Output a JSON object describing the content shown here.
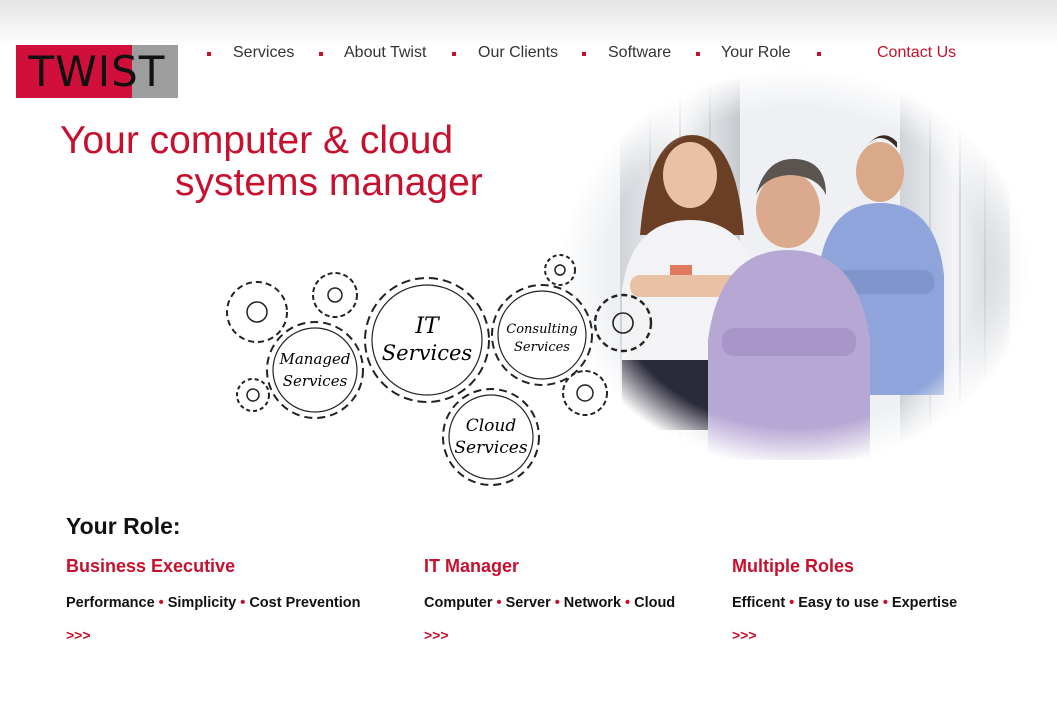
{
  "logo": {
    "text": "TWIST"
  },
  "nav": {
    "items": [
      {
        "label": "Services"
      },
      {
        "label": "About Twist"
      },
      {
        "label": "Our Clients"
      },
      {
        "label": "Software"
      },
      {
        "label": "Your Role"
      }
    ],
    "contact_label": "Contact Us"
  },
  "hero": {
    "title_line1": "Your computer & cloud",
    "title_line2": "systems manager"
  },
  "gears": {
    "it": [
      "IT",
      "Services"
    ],
    "managed": [
      "Managed",
      "Services"
    ],
    "consulting": [
      "Consulting",
      "Services"
    ],
    "cloud": [
      "Cloud",
      "Services"
    ]
  },
  "section": {
    "heading": "Your Role:",
    "columns": [
      {
        "title": "Business Executive",
        "items": [
          "Performance",
          "Simplicity",
          "Cost Prevention"
        ],
        "more": ">>>"
      },
      {
        "title": "IT Manager",
        "items": [
          "Computer",
          "Server",
          "Network",
          "Cloud"
        ],
        "more": ">>>"
      },
      {
        "title": "Multiple Roles",
        "items": [
          "Efficent",
          "Easy to use",
          "Expertise"
        ],
        "more": ">>>"
      }
    ]
  },
  "colors": {
    "accent": "#c8102e",
    "logo_red": "#d0103a",
    "logo_grey": "#9d9d9d"
  },
  "icons": {
    "bullet": "square-bullet-icon",
    "gears": "gear-icon"
  }
}
